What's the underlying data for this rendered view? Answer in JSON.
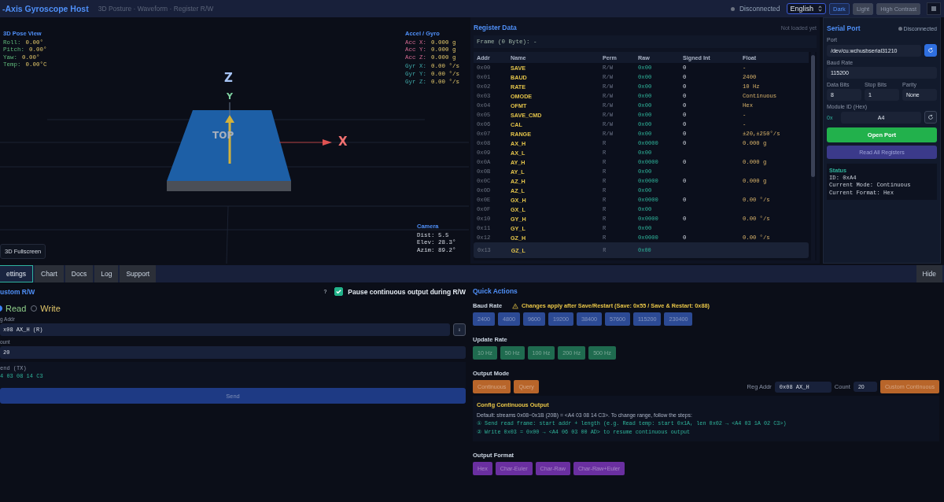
{
  "header": {
    "title": "-Axis Gyroscope Host",
    "subtitle": "3D Posture · Waveform · Register R/W",
    "status": "Disconnected",
    "language": "English",
    "themes": [
      {
        "label": "Dark",
        "selected": true
      },
      {
        "label": "Light",
        "selected": false
      },
      {
        "label": "High Contrast",
        "selected": false
      }
    ]
  },
  "pose_view": {
    "title": "3D Pose View",
    "readouts": [
      {
        "label": "Roll:",
        "value": "0.00°"
      },
      {
        "label": "Pitch:",
        "value": "0.00°"
      },
      {
        "label": "Yaw:",
        "value": "0.00°"
      },
      {
        "label": "Temp:",
        "value": "0.00°C"
      }
    ],
    "accel": {
      "title": "Accel / Gyro",
      "rows": [
        {
          "kind": "acc",
          "label": "Acc X:",
          "value": "0.000 g"
        },
        {
          "kind": "acc",
          "label": "Acc Y:",
          "value": "0.000 g"
        },
        {
          "kind": "acc",
          "label": "Acc Z:",
          "value": "0.000 g"
        },
        {
          "kind": "gyr",
          "label": "Gyr X:",
          "value": "0.00 °/s"
        },
        {
          "kind": "gyr",
          "label": "Gyr Y:",
          "value": "0.00 °/s"
        },
        {
          "kind": "gyr",
          "label": "Gyr Z:",
          "value": "0.00 °/s"
        }
      ]
    },
    "axes": {
      "z": "Z",
      "y": "Y",
      "x": "X"
    },
    "board_label": "TOP",
    "camera": {
      "title": "Camera",
      "rows": [
        "Dist: 5.5",
        "Elev: 28.3°",
        "Azim: 89.2°"
      ]
    },
    "fullscreen_button": "3D Fullscreen"
  },
  "registers": {
    "title": "Register Data",
    "status": "Not loaded yet",
    "frame": "Frame (0 Byte): -",
    "columns": [
      "Addr",
      "Name",
      "Perm",
      "Raw",
      "Signed Int",
      "Float"
    ],
    "rows": [
      {
        "addr": "0x00",
        "name": "SAVE",
        "perm": "R/W",
        "raw": "0x00",
        "signed": "0",
        "float": "-",
        "selected": false
      },
      {
        "addr": "0x01",
        "name": "BAUD",
        "perm": "R/W",
        "raw": "0x00",
        "signed": "0",
        "float": "2400",
        "selected": false
      },
      {
        "addr": "0x02",
        "name": "RATE",
        "perm": "R/W",
        "raw": "0x00",
        "signed": "0",
        "float": "10 Hz",
        "selected": false
      },
      {
        "addr": "0x03",
        "name": "OMODE",
        "perm": "R/W",
        "raw": "0x00",
        "signed": "0",
        "float": "Continuous",
        "selected": false
      },
      {
        "addr": "0x04",
        "name": "OFMT",
        "perm": "R/W",
        "raw": "0x00",
        "signed": "0",
        "float": "Hex",
        "selected": false
      },
      {
        "addr": "0x05",
        "name": "SAVE_CMD",
        "perm": "R/W",
        "raw": "0x00",
        "signed": "0",
        "float": "-",
        "selected": false
      },
      {
        "addr": "0x06",
        "name": "CAL",
        "perm": "R/W",
        "raw": "0x00",
        "signed": "0",
        "float": "-",
        "selected": false
      },
      {
        "addr": "0x07",
        "name": "RANGE",
        "perm": "R/W",
        "raw": "0x00",
        "signed": "0",
        "float": "±20,±250°/s",
        "selected": false
      },
      {
        "addr": "0x08",
        "name": "AX_H",
        "perm": "R",
        "raw": "0x0000",
        "signed": "0",
        "float": "0.000 g",
        "selected": false
      },
      {
        "addr": "0x09",
        "name": "AX_L",
        "perm": "R",
        "raw": "0x00",
        "selected": false
      },
      {
        "addr": "0x0A",
        "name": "AY_H",
        "perm": "R",
        "raw": "0x0000",
        "signed": "0",
        "float": "0.000 g",
        "selected": false
      },
      {
        "addr": "0x0B",
        "name": "AY_L",
        "perm": "R",
        "raw": "0x00",
        "selected": false
      },
      {
        "addr": "0x0C",
        "name": "AZ_H",
        "perm": "R",
        "raw": "0x0000",
        "signed": "0",
        "float": "0.000 g",
        "selected": false
      },
      {
        "addr": "0x0D",
        "name": "AZ_L",
        "perm": "R",
        "raw": "0x00",
        "selected": false
      },
      {
        "addr": "0x0E",
        "name": "GX_H",
        "perm": "R",
        "raw": "0x0000",
        "signed": "0",
        "float": "0.00 °/s",
        "selected": false
      },
      {
        "addr": "0x0F",
        "name": "GX_L",
        "perm": "R",
        "raw": "0x00",
        "selected": false
      },
      {
        "addr": "0x10",
        "name": "GY_H",
        "perm": "R",
        "raw": "0x0000",
        "signed": "0",
        "float": "0.00 °/s",
        "selected": false
      },
      {
        "addr": "0x11",
        "name": "GY_L",
        "perm": "R",
        "raw": "0x00",
        "selected": false
      },
      {
        "addr": "0x12",
        "name": "GZ_H",
        "perm": "R",
        "raw": "0x0000",
        "signed": "0",
        "float": "0.00 °/s",
        "selected": false
      },
      {
        "addr": "0x13",
        "name": "GZ_L",
        "perm": "R",
        "raw": "0x00",
        "selected": true
      }
    ]
  },
  "serial": {
    "title": "Serial Port",
    "status": "Disconnected",
    "port_label": "Port",
    "port": "/dev/cu.wchusbserial31210",
    "baud_label": "Baud Rate",
    "baud": "115200",
    "params": [
      {
        "label": "Data Bits",
        "value": "8"
      },
      {
        "label": "Stop Bits",
        "value": "1"
      },
      {
        "label": "Parity",
        "value": "None"
      }
    ],
    "module_label": "Module ID (Hex)",
    "module_prefix": "0x",
    "module_id": "A4",
    "open_button": "Open Port",
    "read_all_button": "Read All Registers",
    "status_box": {
      "title": "Status",
      "lines": [
        "ID: 0xA4",
        "Current Mode: Continuous",
        "Current Format: Hex"
      ]
    }
  },
  "tabs": [
    {
      "label": "ettings",
      "selected": true
    },
    {
      "label": "Chart",
      "selected": false
    },
    {
      "label": "Docs",
      "selected": false
    },
    {
      "label": "Log",
      "selected": false
    },
    {
      "label": "Support",
      "selected": false
    }
  ],
  "hide_button": "Hide",
  "custom_rw": {
    "title": "ustom R/W",
    "help": "?",
    "pause": {
      "label": "Pause continuous output during R/W",
      "checked": true
    },
    "modes": [
      {
        "label": "Read",
        "selected": true
      },
      {
        "label": "Write",
        "selected": false
      }
    ],
    "addr_label": "g Addr",
    "addr": "x08 AX_H (R)",
    "count_label": "ount",
    "count": "20",
    "tx_label": "end (TX)",
    "tx": "4 03 08 14 C3",
    "send_button": "Send"
  },
  "quick_actions": {
    "title": "Quick Actions",
    "sections": [
      {
        "label": "Baud Rate",
        "color": "#2c4a94",
        "warning": "Changes apply after Save/Restart (Save: 0x55 / Save & Restart: 0x88)",
        "buttons": [
          "2400",
          "4800",
          "9600",
          "19200",
          "38400",
          "57600",
          "115200",
          "230400"
        ]
      },
      {
        "label": "Update Rate",
        "color": "#1f6b4f",
        "buttons": [
          "10 Hz",
          "50 Hz",
          "100 Hz",
          "200 Hz",
          "500 Hz"
        ]
      },
      {
        "label": "Output Mode",
        "color": "#b8652a",
        "buttons": [
          "Continuous",
          "Query"
        ],
        "custom": {
          "addr_label": "Reg Addr",
          "addr": "0x08 AX_H",
          "count_label": "Count",
          "count": "20",
          "button": "Custom Continuous"
        },
        "config": {
          "title": "Config Continuous Output",
          "text": "Default: streams 0x08~0x1B (20B) = <A4 03 08 14 C3>. To change range, follow the steps:",
          "steps": [
            "① Send read frame: start addr + length (e.g. Read temp: start 0x1A, len 0x02 → <A4 03 1A 02 C3>)",
            "② Write 0x03 = 0x00 → <A4 06 03 00 AD> to resume continuous output"
          ]
        }
      },
      {
        "label": "Output Format",
        "color": "#6a2fa0",
        "buttons": [
          "Hex",
          "Char-Euler",
          "Char-Raw",
          "Char-Raw+Euler"
        ]
      }
    ]
  }
}
